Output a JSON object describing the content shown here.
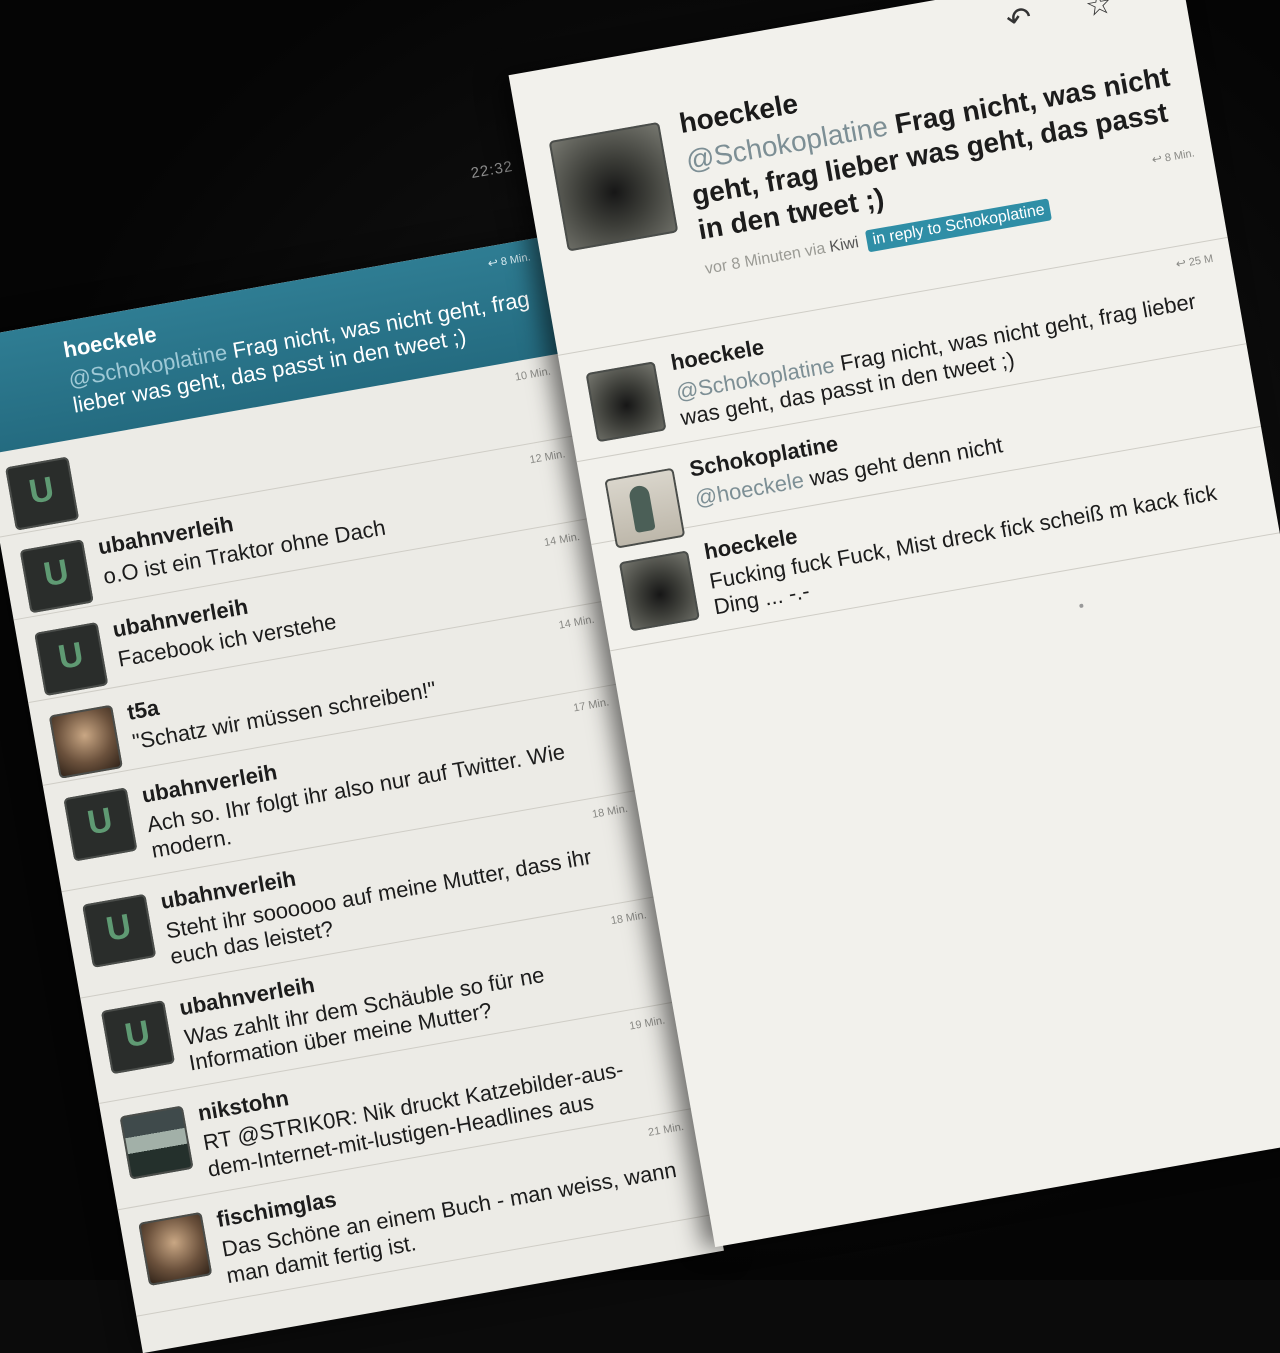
{
  "status_bar": {
    "clock": "22:32"
  },
  "timeline": {
    "selected": {
      "user": "hoeckele",
      "mention": "@Schokoplatine",
      "text": " Frag nicht, was nicht geht, frag lieber was geht, das passt in den tweet ;)",
      "time": "8 Min."
    },
    "tweets": [
      {
        "user": "",
        "text": "",
        "time": "10 Min.",
        "avatar": "u"
      },
      {
        "user": "ubahnverleih",
        "text": "o.O ist ein Traktor ohne Dach",
        "time": "12 Min.",
        "avatar": "u"
      },
      {
        "user": "ubahnverleih",
        "text": "Facebook ich verstehe",
        "time": "14 Min.",
        "avatar": "u"
      },
      {
        "user": "t5a",
        "text": "\"Schatz wir müssen schreiben!\"",
        "time": "14 Min.",
        "avatar": "face"
      },
      {
        "user": "ubahnverleih",
        "text": "Ach so. Ihr folgt ihr also nur auf Twitter. Wie modern.",
        "time": "17 Min.",
        "avatar": "u"
      },
      {
        "user": "ubahnverleih",
        "text": "Steht ihr soooooo auf meine Mutter, dass ihr euch das leistet?",
        "time": "18 Min.",
        "avatar": "u"
      },
      {
        "user": "ubahnverleih",
        "text": "Was zahlt ihr dem Schäuble so für ne Information über meine Mutter?",
        "time": "18 Min.",
        "avatar": "u"
      },
      {
        "user": "nikstohn",
        "text": "RT @STRIK0R: Nik druckt Katzebilder-aus-dem-Internet-mit-lustigen-Headlines aus",
        "time": "19 Min.",
        "avatar": "pix"
      },
      {
        "user": "fischimglas",
        "text": "Das Schöne an einem Buch - man weiss, wann man damit fertig ist.",
        "time": "21 Min.",
        "avatar": "face"
      }
    ]
  },
  "detail": {
    "toolbar": {
      "reply_icon": "reply-arrow-icon",
      "favorite_icon": "star-icon"
    },
    "main": {
      "user": "hoeckele",
      "mention": "@Schokoplatine",
      "text": " Frag nicht, was nicht geht, frag lieber was geht, das passt in den tweet ;)",
      "ago": "vor 8 Minuten",
      "via": "via",
      "client": "Kiwi",
      "reply_badge": "in reply to Schokoplatine",
      "time": "8 Min."
    },
    "conversation": [
      {
        "user": "hoeckele",
        "mention": "@Schokoplatine",
        "text": " Frag nicht, was nicht geht, frag lieber was geht, das passt in den tweet ;)",
        "time": "25 M",
        "avatar": "shadow"
      },
      {
        "user": "Schokoplatine",
        "mention": "@hoeckele",
        "text": " was geht denn nicht",
        "time": "",
        "avatar": "person"
      },
      {
        "user": "hoeckele",
        "mention": "",
        "text": "Fucking fuck Fuck, Mist dreck fick scheiß m kack fick Ding ... -.-",
        "time": "",
        "avatar": "shadow"
      }
    ]
  },
  "colors": {
    "selected_bg": "#2f7d93",
    "badge_bg": "#2f8ea6",
    "pane_bg": "#f2f1ec"
  }
}
